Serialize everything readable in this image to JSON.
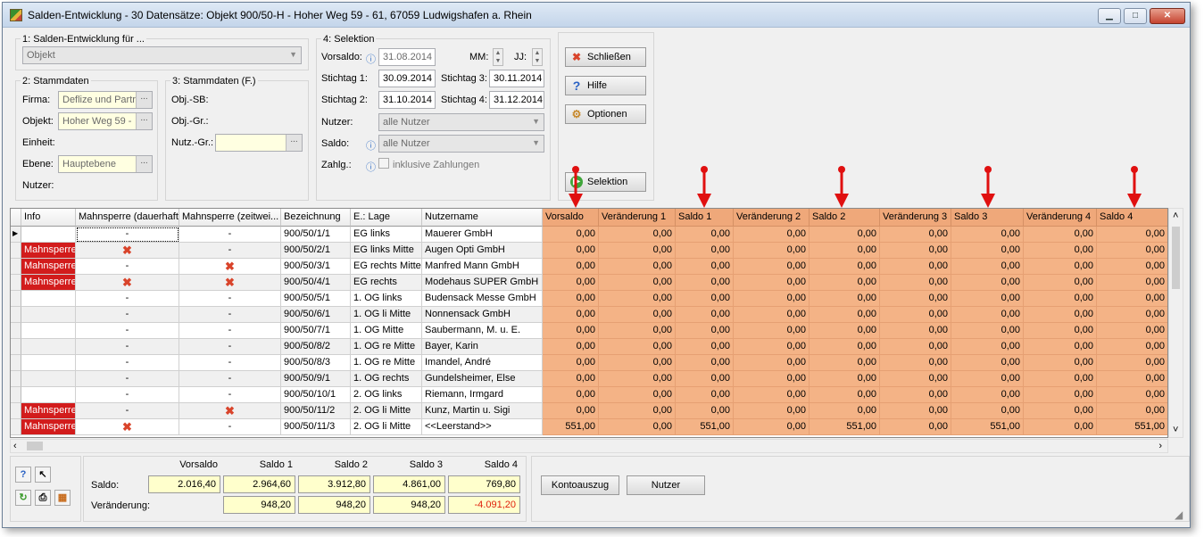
{
  "window": {
    "title": "Salden-Entwicklung - 30 Datensätze:  Objekt 900/50-H - Hoher Weg 59 - 61, 67059 Ludwigshafen a. Rhein",
    "controls": {
      "minimize": "▁",
      "maximize": "□",
      "close": "✕"
    }
  },
  "group1": {
    "title": "1: Salden-Entwicklung für ...",
    "select_value": "Objekt"
  },
  "group2": {
    "title": "2: Stammdaten",
    "firma_label": "Firma:",
    "firma_value": "Deflize und Partr",
    "objekt_label": "Objekt:",
    "objekt_value": "Hoher Weg 59 -",
    "einheit_label": "Einheit:",
    "ebene_label": "Ebene:",
    "ebene_value": "Hauptebene",
    "nutzer_label": "Nutzer:",
    "dots": "..."
  },
  "group3": {
    "title": "3: Stammdaten (F.)",
    "objsb_label": "Obj.-SB:",
    "objgr_label": "Obj.-Gr.:",
    "nutzgr_label": "Nutz.-Gr.:"
  },
  "group4": {
    "title": "4: Selektion",
    "vorsaldo_label": "Vorsaldo:",
    "vorsaldo_value": "31.08.2014",
    "mm_label": "MM:",
    "jj_label": "JJ:",
    "stichtag1_label": "Stichtag 1:",
    "stichtag1_value": "30.09.2014",
    "stichtag2_label": "Stichtag 2:",
    "stichtag2_value": "31.10.2014",
    "stichtag3_label": "Stichtag 3:",
    "stichtag3_value": "30.11.2014",
    "stichtag4_label": "Stichtag 4:",
    "stichtag4_value": "31.12.2014",
    "nutzer_label": "Nutzer:",
    "nutzer_value": "alle Nutzer",
    "saldo_label": "Saldo:",
    "saldo_value": "alle Nutzer",
    "zahlg_label": "Zahlg.:",
    "zahlg_checkbox_label": "inklusive Zahlungen"
  },
  "buttons": {
    "schliessen": "Schließen",
    "hilfe": "Hilfe",
    "optionen": "Optionen",
    "selektion": "Selektion"
  },
  "grid": {
    "columns": [
      "Info",
      "Mahnsperre (dauerhaft)",
      "Mahnsperre (zeitwei...",
      "Bezeichnung",
      "E.: Lage",
      "Nutzername",
      "Vorsaldo",
      "Veränderung 1",
      "Saldo 1",
      "Veränderung 2",
      "Saldo 2",
      "Veränderung 3",
      "Saldo 3",
      "Veränderung 4",
      "Saldo 4"
    ],
    "rows": [
      {
        "info": "",
        "md": "-",
        "mz": "-",
        "bez": "900/50/1/1",
        "lage": "EG links",
        "nutzer": "Mauerer GmbH",
        "vals": [
          "0,00",
          "0,00",
          "0,00",
          "0,00",
          "0,00",
          "0,00",
          "0,00",
          "0,00",
          "0,00"
        ]
      },
      {
        "info": "Mahnsperre",
        "md": "✖",
        "mz": "-",
        "bez": "900/50/2/1",
        "lage": "EG links Mitte",
        "nutzer": "Augen Opti GmbH",
        "vals": [
          "0,00",
          "0,00",
          "0,00",
          "0,00",
          "0,00",
          "0,00",
          "0,00",
          "0,00",
          "0,00"
        ]
      },
      {
        "info": "Mahnsperre",
        "md": "-",
        "mz": "✖",
        "bez": "900/50/3/1",
        "lage": "EG rechts Mitte",
        "nutzer": "Manfred Mann GmbH",
        "vals": [
          "0,00",
          "0,00",
          "0,00",
          "0,00",
          "0,00",
          "0,00",
          "0,00",
          "0,00",
          "0,00"
        ]
      },
      {
        "info": "Mahnsperre",
        "md": "✖",
        "mz": "✖",
        "bez": "900/50/4/1",
        "lage": "EG rechts",
        "nutzer": "Modehaus SUPER GmbH",
        "vals": [
          "0,00",
          "0,00",
          "0,00",
          "0,00",
          "0,00",
          "0,00",
          "0,00",
          "0,00",
          "0,00"
        ]
      },
      {
        "info": "",
        "md": "-",
        "mz": "-",
        "bez": "900/50/5/1",
        "lage": "1. OG links",
        "nutzer": "Budensack Messe GmbH",
        "vals": [
          "0,00",
          "0,00",
          "0,00",
          "0,00",
          "0,00",
          "0,00",
          "0,00",
          "0,00",
          "0,00"
        ]
      },
      {
        "info": "",
        "md": "-",
        "mz": "-",
        "bez": "900/50/6/1",
        "lage": "1. OG li Mitte",
        "nutzer": "Nonnensack GmbH",
        "vals": [
          "0,00",
          "0,00",
          "0,00",
          "0,00",
          "0,00",
          "0,00",
          "0,00",
          "0,00",
          "0,00"
        ]
      },
      {
        "info": "",
        "md": "-",
        "mz": "-",
        "bez": "900/50/7/1",
        "lage": "1. OG Mitte",
        "nutzer": "Saubermann, M. u. E.",
        "vals": [
          "0,00",
          "0,00",
          "0,00",
          "0,00",
          "0,00",
          "0,00",
          "0,00",
          "0,00",
          "0,00"
        ]
      },
      {
        "info": "",
        "md": "-",
        "mz": "-",
        "bez": "900/50/8/2",
        "lage": "1. OG re Mitte",
        "nutzer": "Bayer, Karin",
        "vals": [
          "0,00",
          "0,00",
          "0,00",
          "0,00",
          "0,00",
          "0,00",
          "0,00",
          "0,00",
          "0,00"
        ]
      },
      {
        "info": "",
        "md": "-",
        "mz": "-",
        "bez": "900/50/8/3",
        "lage": "1. OG re Mitte",
        "nutzer": "Imandel, André",
        "vals": [
          "0,00",
          "0,00",
          "0,00",
          "0,00",
          "0,00",
          "0,00",
          "0,00",
          "0,00",
          "0,00"
        ]
      },
      {
        "info": "",
        "md": "-",
        "mz": "-",
        "bez": "900/50/9/1",
        "lage": "1. OG rechts",
        "nutzer": "Gundelsheimer, Else",
        "vals": [
          "0,00",
          "0,00",
          "0,00",
          "0,00",
          "0,00",
          "0,00",
          "0,00",
          "0,00",
          "0,00"
        ]
      },
      {
        "info": "",
        "md": "-",
        "mz": "-",
        "bez": "900/50/10/1",
        "lage": "2. OG links",
        "nutzer": "Riemann, Irmgard",
        "vals": [
          "0,00",
          "0,00",
          "0,00",
          "0,00",
          "0,00",
          "0,00",
          "0,00",
          "0,00",
          "0,00"
        ]
      },
      {
        "info": "Mahnsperre",
        "md": "-",
        "mz": "✖",
        "bez": "900/50/11/2",
        "lage": "2. OG li Mitte",
        "nutzer": "Kunz, Martin u. Sigi",
        "vals": [
          "0,00",
          "0,00",
          "0,00",
          "0,00",
          "0,00",
          "0,00",
          "0,00",
          "0,00",
          "0,00"
        ]
      },
      {
        "info": "Mahnsperre",
        "md": "✖",
        "mz": "-",
        "bez": "900/50/11/3",
        "lage": "2. OG li Mitte",
        "nutzer": "<<Leerstand>>",
        "vals": [
          "551,00",
          "0,00",
          "551,00",
          "0,00",
          "551,00",
          "0,00",
          "551,00",
          "0,00",
          "551,00"
        ]
      }
    ]
  },
  "summary": {
    "headers": [
      "Vorsaldo",
      "Saldo 1",
      "Saldo 2",
      "Saldo 3",
      "Saldo 4"
    ],
    "saldo_label": "Saldo:",
    "saldo_values": [
      "2.016,40",
      "2.964,60",
      "3.912,80",
      "4.861,00",
      "769,80"
    ],
    "veraenderung_label": "Veränderung:",
    "veraenderung_values": [
      "948,20",
      "948,20",
      "948,20",
      "-4.091,20"
    ],
    "kontoauszug": "Kontoauszug",
    "nutzer_button": "Nutzer"
  },
  "colors": {
    "highlight_orange": "#f4b386",
    "mahnsperre_red": "#d21c1c",
    "annotation_arrow": "#e01010"
  }
}
